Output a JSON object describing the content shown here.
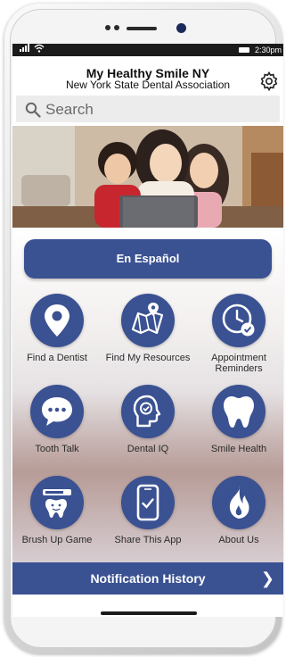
{
  "status_bar": {
    "time": "2:30pm"
  },
  "header": {
    "title": "My Healthy Smile NY",
    "subtitle": "New York State Dental Association",
    "settings_icon": "gear-icon"
  },
  "search": {
    "placeholder": "Search",
    "icon": "search-icon"
  },
  "hero": {
    "description_icon": "family-photo"
  },
  "language_button": "En Español",
  "tiles": [
    {
      "label": "Find a Dentist",
      "icon": "location-pin-icon"
    },
    {
      "label": "Find My Resources",
      "icon": "map-icon"
    },
    {
      "label": "Appointment Reminders",
      "icon": "clock-check-icon"
    },
    {
      "label": "Tooth Talk",
      "icon": "chat-bubble-icon"
    },
    {
      "label": "Dental IQ",
      "icon": "head-check-icon"
    },
    {
      "label": "Smile Health",
      "icon": "tooth-icon"
    },
    {
      "label": "Brush Up Game",
      "icon": "toothbrush-icon"
    },
    {
      "label": "Share This App",
      "icon": "phone-check-icon"
    },
    {
      "label": "About Us",
      "icon": "flame-icon"
    }
  ],
  "notification_history": {
    "label": "Notification History",
    "icon": "chevron-right-icon"
  },
  "colors": {
    "brand_blue": "#3a5192",
    "status_bar": "#1b1b1b"
  }
}
